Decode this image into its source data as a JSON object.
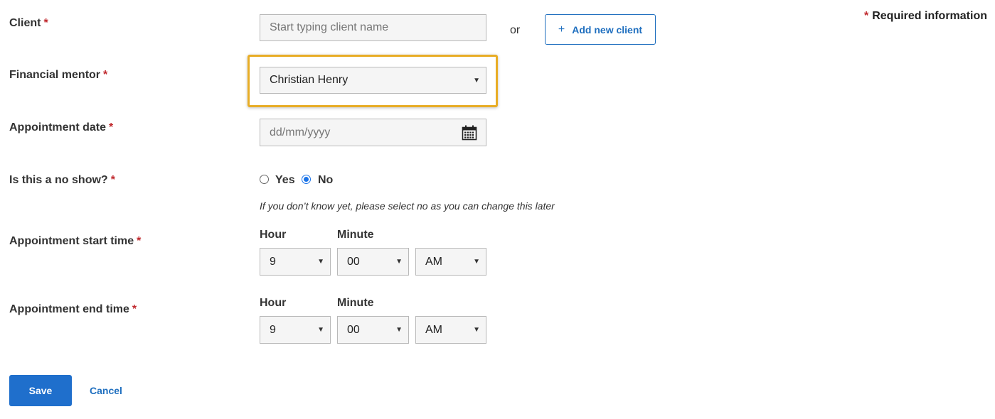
{
  "required_info": {
    "star": "*",
    "text": "Required information"
  },
  "client": {
    "label": "Client",
    "required_marker": "*",
    "placeholder": "Start typing client name",
    "or_text": "or",
    "add_button_icon": "plus-icon",
    "add_button_label": "Add new client"
  },
  "financial_mentor": {
    "label": "Financial mentor",
    "required_marker": "*",
    "selected": "Christian Henry",
    "highlight_color": "#e8ad26"
  },
  "appointment_date": {
    "label": "Appointment date",
    "required_marker": "*",
    "placeholder": "dd/mm/yyyy",
    "icon": "calendar-icon"
  },
  "no_show": {
    "label": "Is this a no show?",
    "required_marker": "*",
    "options": [
      {
        "label": "Yes",
        "checked": false
      },
      {
        "label": "No",
        "checked": true
      }
    ],
    "hint": "If you don’t know yet, please select no as you can change this later"
  },
  "start_time": {
    "label": "Appointment start time",
    "required_marker": "*",
    "hour_label": "Hour",
    "minute_label": "Minute",
    "hour": "9",
    "minute": "00",
    "period": "AM"
  },
  "end_time": {
    "label": "Appointment end time",
    "required_marker": "*",
    "hour_label": "Hour",
    "minute_label": "Minute",
    "hour": "9",
    "minute": "00",
    "period": "AM"
  },
  "actions": {
    "save_label": "Save",
    "cancel_label": "Cancel",
    "primary_color": "#1f6fcc"
  }
}
